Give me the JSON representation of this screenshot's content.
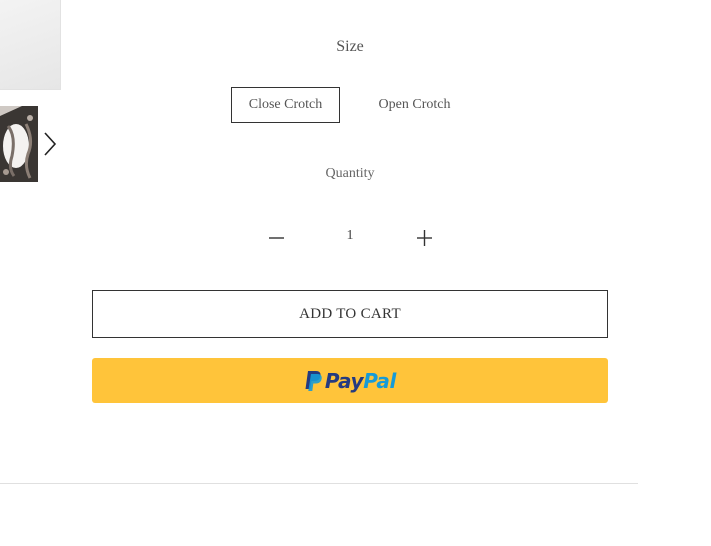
{
  "gallery": {
    "thumbnails": [
      {
        "icon": "product-photo-top"
      },
      {
        "icon": "product-photo-hands"
      }
    ],
    "next_icon": "chevron-right-icon"
  },
  "size": {
    "label": "Size",
    "options": [
      {
        "label": "Close Crotch",
        "selected": true
      },
      {
        "label": "Open Crotch",
        "selected": false
      }
    ]
  },
  "quantity": {
    "label": "Quantity",
    "value": "1",
    "minus_icon": "minus-icon",
    "plus_icon": "plus-icon"
  },
  "actions": {
    "add_to_cart_label": "ADD TO CART",
    "paypal": {
      "label_pay": "Pay",
      "label_pal": "Pal",
      "background": "#ffc43a",
      "pay_color": "#253b80",
      "pal_color": "#179bd7"
    }
  }
}
